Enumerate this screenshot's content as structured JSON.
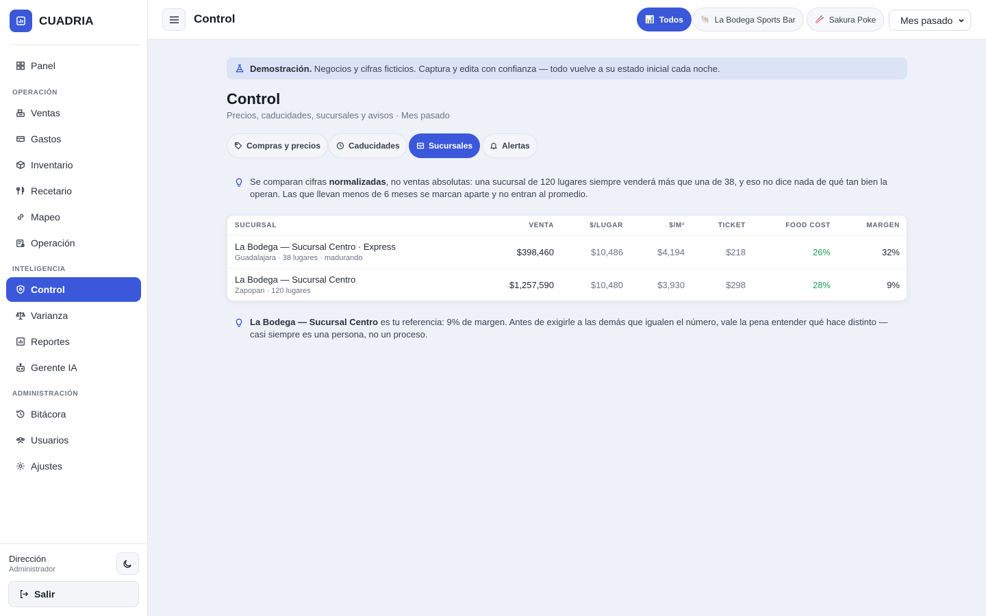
{
  "app": {
    "brand": "CUADRIA"
  },
  "sidebar": {
    "top_item": {
      "label": "Panel",
      "icon": "grid-icon"
    },
    "sections": [
      {
        "title": "OPERACIÓN",
        "items": [
          {
            "label": "Ventas",
            "icon": "cash-register-icon"
          },
          {
            "label": "Gastos",
            "icon": "card-icon"
          },
          {
            "label": "Inventario",
            "icon": "box-icon"
          },
          {
            "label": "Recetario",
            "icon": "utensils-icon"
          },
          {
            "label": "Mapeo",
            "icon": "link-icon"
          },
          {
            "label": "Operación",
            "icon": "clipboard-gear-icon"
          }
        ]
      },
      {
        "title": "INTELIGENCIA",
        "items": [
          {
            "label": "Control",
            "icon": "shield-icon",
            "active": true
          },
          {
            "label": "Varianza",
            "icon": "scale-icon"
          },
          {
            "label": "Reportes",
            "icon": "chart-icon"
          },
          {
            "label": "Gerente IA",
            "icon": "robot-icon"
          }
        ]
      },
      {
        "title": "ADMINISTRACIÓN",
        "items": [
          {
            "label": "Bitácora",
            "icon": "history-icon"
          },
          {
            "label": "Usuarios",
            "icon": "users-icon"
          },
          {
            "label": "Ajustes",
            "icon": "gear-icon"
          }
        ]
      }
    ],
    "user": {
      "name": "Dirección",
      "role": "Administrador"
    },
    "logout_label": "Salir"
  },
  "topbar": {
    "title": "Control",
    "filters": [
      {
        "label": "Todos",
        "emoji": "📊",
        "active": true
      },
      {
        "label": "La Bodega Sports Bar",
        "emoji": "🐚"
      },
      {
        "label": "Sakura Poke",
        "emoji": "🥢"
      }
    ],
    "period": "Mes pasado"
  },
  "main": {
    "banner_strong": "Demostración.",
    "banner_text": " Negocios y cifras ficticios. Captura y edita con confianza — todo vuelve a su estado inicial cada noche.",
    "title": "Control",
    "subtitle": "Precios, caducidades, sucursales y avisos · Mes pasado",
    "tabs": [
      {
        "label": "Compras y precios",
        "icon": "tag-icon"
      },
      {
        "label": "Caducidades",
        "icon": "clock-icon"
      },
      {
        "label": "Sucursales",
        "icon": "store-icon",
        "active": true
      },
      {
        "label": "Alertas",
        "icon": "bell-icon"
      }
    ],
    "note1": {
      "pre": "Se comparan cifras ",
      "strong": "normalizadas",
      "post": ", no ventas absolutas: una sucursal de 120 lugares siempre venderá más que una de 38, y eso no dice nada de qué tan bien la operan. Las que llevan menos de 6 meses se marcan aparte y no entran al promedio."
    },
    "table": {
      "headers": [
        "SUCURSAL",
        "VENTA",
        "$/LUGAR",
        "$/M²",
        "TICKET",
        "FOOD COST",
        "MARGEN"
      ],
      "rows": [
        {
          "name": "La Bodega — Sucursal Centro · Express",
          "meta": "Guadalajara · 38 lugares · madurando",
          "venta": "$398,460",
          "por_lugar": "$10,486",
          "por_m2": "$4,194",
          "ticket": "$218",
          "food_cost": "26%",
          "margen": "32%"
        },
        {
          "name": "La Bodega — Sucursal Centro",
          "meta": "Zapopan · 120 lugares",
          "venta": "$1,257,590",
          "por_lugar": "$10,480",
          "por_m2": "$3,930",
          "ticket": "$298",
          "food_cost": "28%",
          "margen": "9%"
        }
      ]
    },
    "note2": {
      "strong": "La Bodega — Sucursal Centro",
      "post": " es tu referencia: 9% de margen. Antes de exigirle a las demás que igualen el número, vale la pena entender qué hace distinto — casi siempre es una persona, no un proceso."
    }
  }
}
